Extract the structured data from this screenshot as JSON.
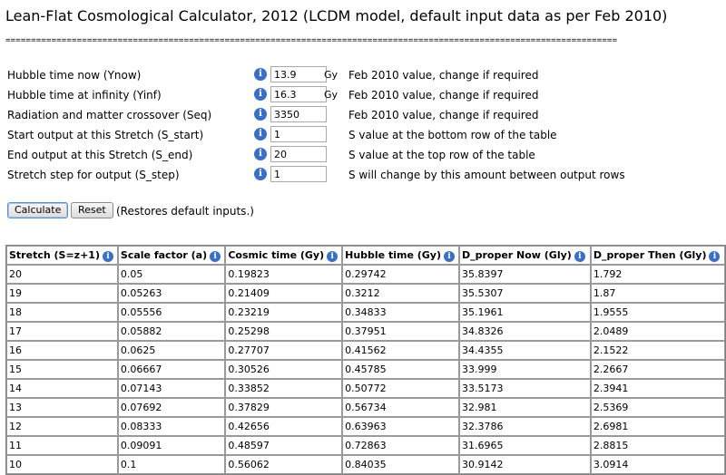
{
  "page": {
    "title": "Lean-Flat Cosmological Calculator, 2012 (LCDM model, default input data as per Feb 2010)",
    "separator": "========================================================================================================================"
  },
  "icons": {
    "info": "info-icon"
  },
  "inputs": [
    {
      "label": "Hubble time now (Ynow)",
      "value": "13.9",
      "unit": "Gy",
      "hint": "Feb 2010 value, change if required"
    },
    {
      "label": "Hubble time at infinity (Yinf)",
      "value": "16.3",
      "unit": "Gy",
      "hint": "Feb 2010 value, change if required"
    },
    {
      "label": "Radiation and matter crossover (Seq)",
      "value": "3350",
      "unit": "",
      "hint": "Feb 2010 value, change if required"
    },
    {
      "label": "Start output at this Stretch (S_start)",
      "value": "1",
      "unit": "",
      "hint": "S value at the bottom row of the table"
    },
    {
      "label": "End output at this Stretch (S_end)",
      "value": "20",
      "unit": "",
      "hint": "S value at the top row of the table"
    },
    {
      "label": "Stretch step for output (S_step)",
      "value": "1",
      "unit": "",
      "hint": "S will change by this amount between output rows"
    }
  ],
  "buttons": {
    "calculate": "Calculate",
    "reset": "Reset",
    "restore_note": "(Restores default inputs.)"
  },
  "table": {
    "headers": [
      "Stretch (S=z+1)",
      "Scale factor (a)",
      "Cosmic time (Gy)",
      "Hubble time (Gy)",
      "D_proper Now (Gly)",
      "D_proper Then (Gly)"
    ],
    "rows": [
      [
        "20",
        "0.05",
        "0.19823",
        "0.29742",
        "35.8397",
        "1.792"
      ],
      [
        "19",
        "0.05263",
        "0.21409",
        "0.3212",
        "35.5307",
        "1.87"
      ],
      [
        "18",
        "0.05556",
        "0.23219",
        "0.34833",
        "35.1961",
        "1.9555"
      ],
      [
        "17",
        "0.05882",
        "0.25298",
        "0.37951",
        "34.8326",
        "2.0489"
      ],
      [
        "16",
        "0.0625",
        "0.27707",
        "0.41562",
        "34.4355",
        "2.1522"
      ],
      [
        "15",
        "0.06667",
        "0.30526",
        "0.45785",
        "33.999",
        "2.2667"
      ],
      [
        "14",
        "0.07143",
        "0.33852",
        "0.50772",
        "33.5173",
        "2.3941"
      ],
      [
        "13",
        "0.07692",
        "0.37829",
        "0.56734",
        "32.981",
        "2.5369"
      ],
      [
        "12",
        "0.08333",
        "0.42656",
        "0.63963",
        "32.3786",
        "2.6981"
      ],
      [
        "11",
        "0.09091",
        "0.48597",
        "0.72863",
        "31.6965",
        "2.8815"
      ],
      [
        "10",
        "0.1",
        "0.56062",
        "0.84035",
        "30.9142",
        "3.0914"
      ]
    ]
  }
}
